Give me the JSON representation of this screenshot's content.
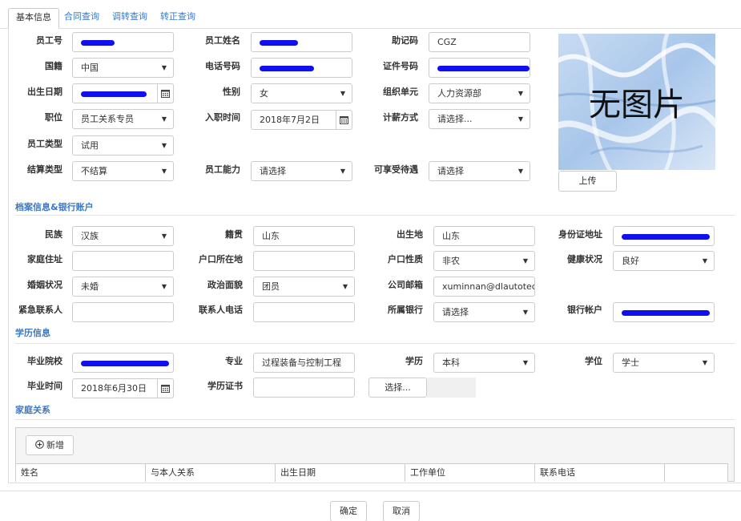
{
  "tabs": [
    {
      "label": "基本信息",
      "active": true
    },
    {
      "label": "合同查询",
      "active": false
    },
    {
      "label": "调转查询",
      "active": false
    },
    {
      "label": "转正查询",
      "active": false
    }
  ],
  "basic": {
    "emp_no_label": "员工号",
    "emp_name_label": "员工姓名",
    "mnemonic_label": "助记码",
    "mnemonic_value": "CGZ",
    "nationality_label": "国籍",
    "nationality_value": "中国",
    "phone_label": "电话号码",
    "id_no_label": "证件号码",
    "birth_label": "出生日期",
    "gender_label": "性别",
    "gender_value": "女",
    "org_label": "组织单元",
    "org_value": "人力资源部",
    "position_label": "职位",
    "position_value": "员工关系专员",
    "hire_label": "入职时间",
    "hire_value": "2018年7月2日",
    "salary_label": "计薪方式",
    "salary_value": "请选择...",
    "emp_type_label": "员工类型",
    "emp_type_value": "试用",
    "settle_label": "结算类型",
    "settle_value": "不结算",
    "ability_label": "员工能力",
    "ability_value": "请选择",
    "benefit_label": "可享受待遇",
    "benefit_value": "请选择",
    "photo_text": "无图片",
    "upload_label": "上传"
  },
  "archive": {
    "title": "档案信息&银行账户",
    "ethnic_label": "民族",
    "ethnic_value": "汉族",
    "native_label": "籍贯",
    "native_value": "山东",
    "birthplace_label": "出生地",
    "birthplace_value": "山东",
    "id_addr_label": "身份证地址",
    "home_label": "家庭住址",
    "hukou_loc_label": "户口所在地",
    "hukou_type_label": "户口性质",
    "hukou_type_value": "非农",
    "health_label": "健康状况",
    "health_value": "良好",
    "marital_label": "婚姻状况",
    "marital_value": "未婚",
    "political_label": "政治面貌",
    "political_value": "团员",
    "email_label": "公司邮箱",
    "email_value": "xuminnan@dlautotech.c",
    "emergency_label": "紧急联系人",
    "contact_phone_label": "联系人电话",
    "bank_label": "所属银行",
    "bank_value": "请选择",
    "account_label": "银行帐户"
  },
  "education": {
    "title": "学历信息",
    "school_label": "毕业院校",
    "major_label": "专业",
    "major_value": "过程装备与控制工程",
    "degree_edu_label": "学历",
    "degree_edu_value": "本科",
    "degree_label": "学位",
    "degree_value": "学士",
    "grad_label": "毕业时间",
    "grad_value": "2018年6月30日",
    "cert_label": "学历证书",
    "choose_label": "选择..."
  },
  "family": {
    "title": "家庭关系",
    "add_label": "新增",
    "columns": [
      "姓名",
      "与本人关系",
      "出生日期",
      "工作单位",
      "联系电话",
      ""
    ]
  },
  "footer": {
    "ok_label": "确定",
    "cancel_label": "取消"
  },
  "colors": {
    "accent": "#3a78c3",
    "redaction": "#1010ee"
  }
}
